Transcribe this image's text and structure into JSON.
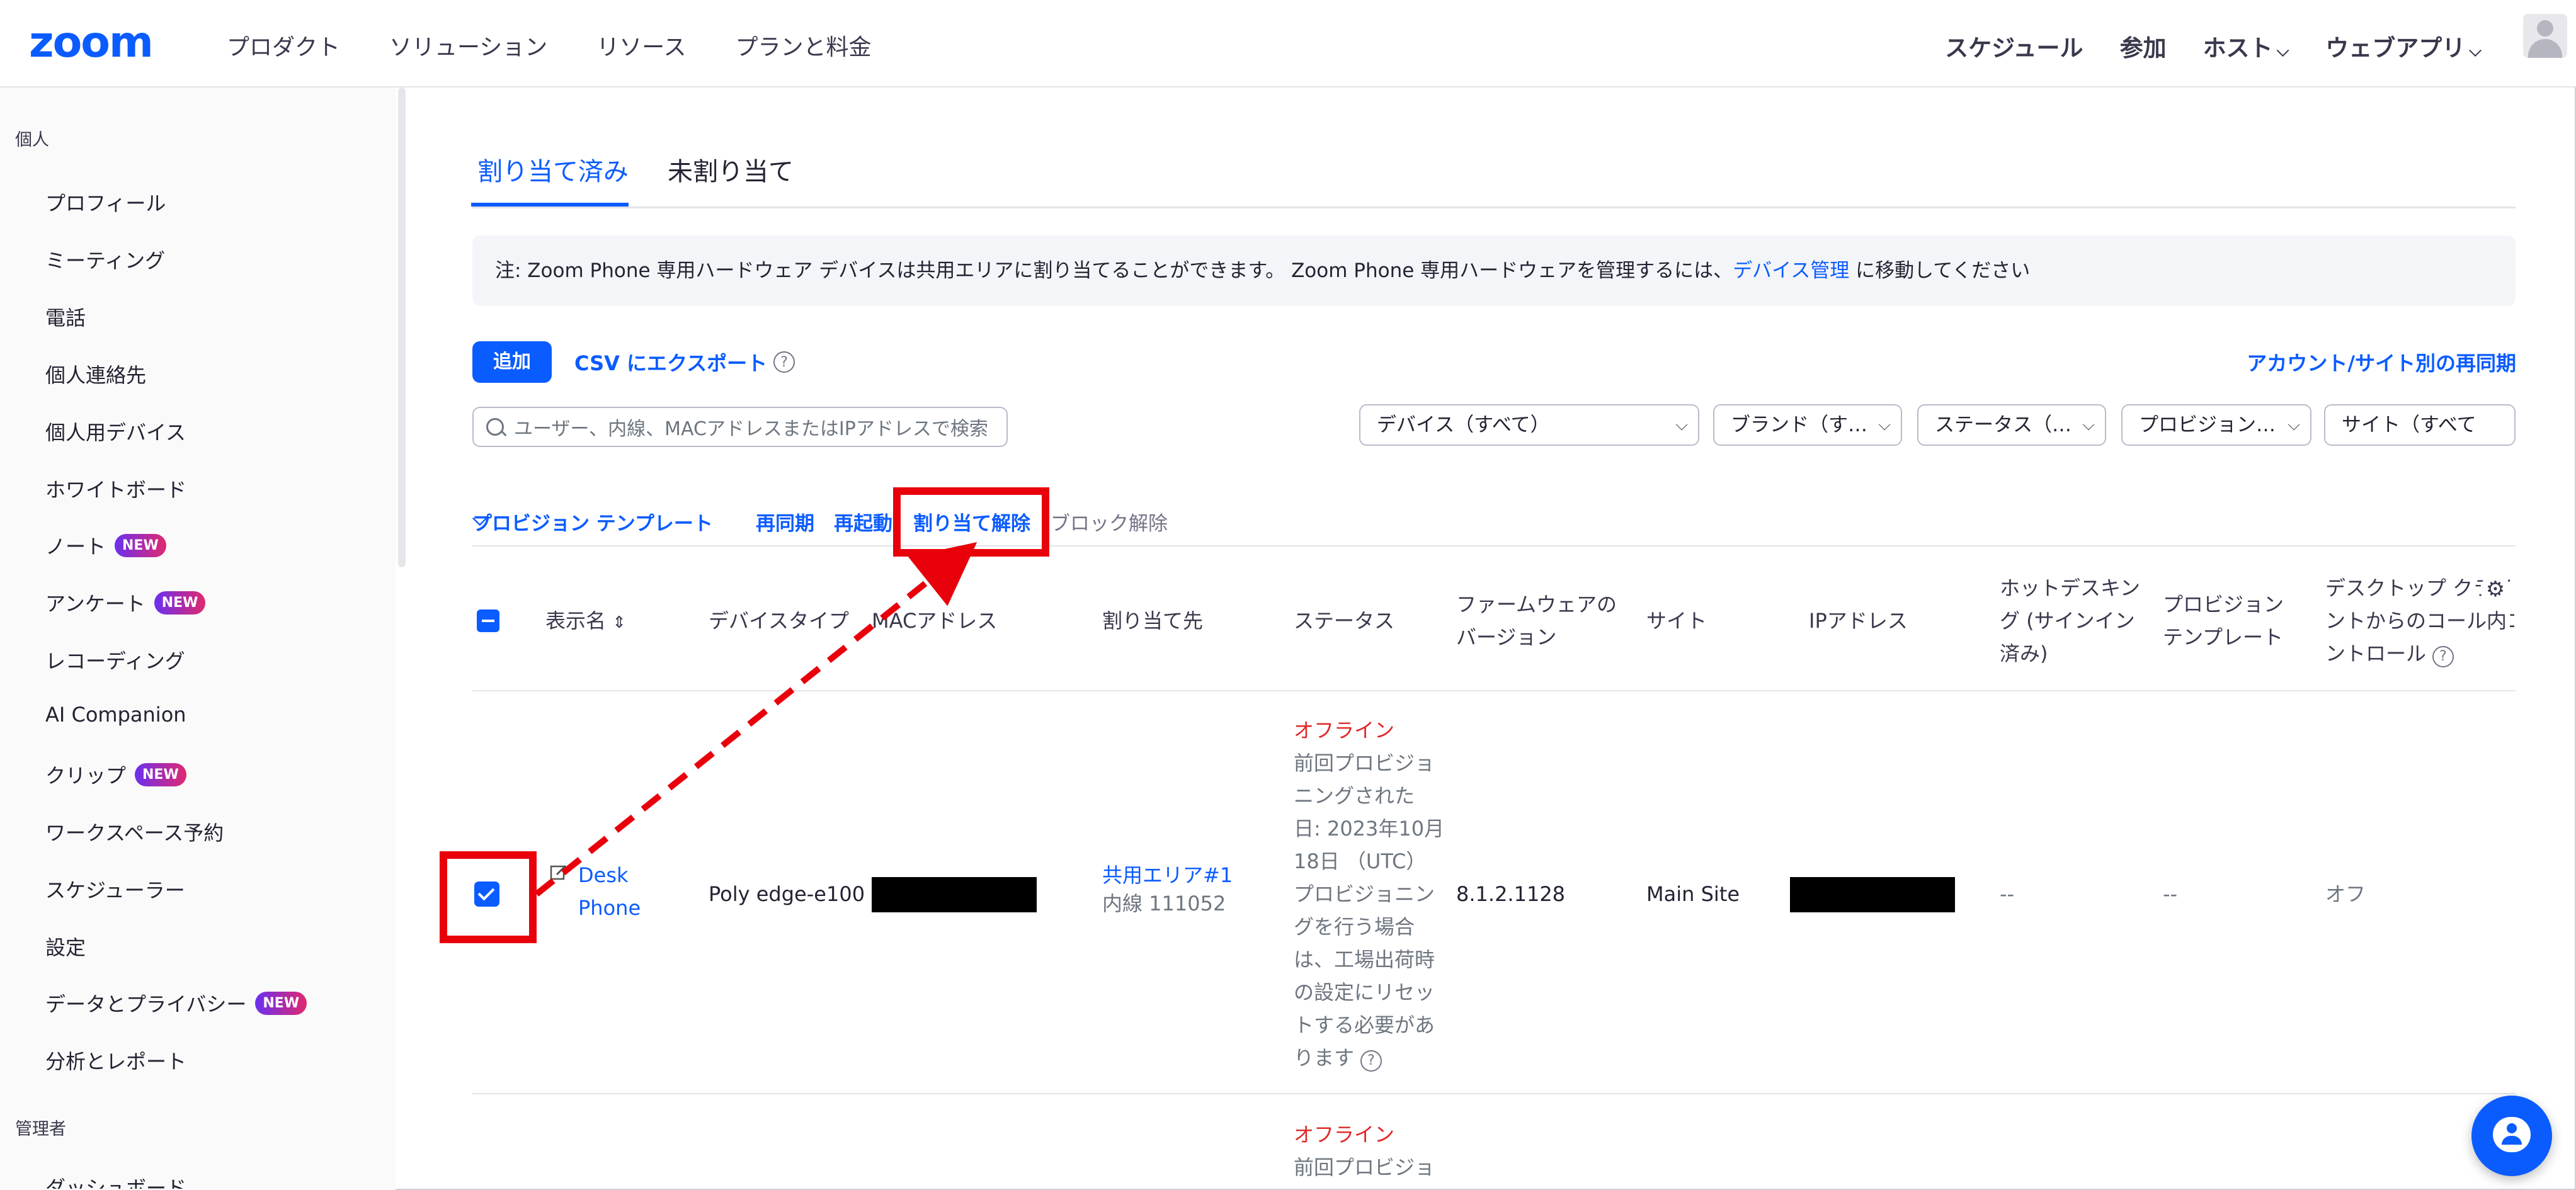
{
  "topnav": {
    "logo": "zoom",
    "left_items": [
      "プロダクト",
      "ソリューション",
      "リソース",
      "プランと料金"
    ],
    "right_items": [
      {
        "label": "スケジュール",
        "dropdown": false
      },
      {
        "label": "参加",
        "dropdown": false
      },
      {
        "label": "ホスト",
        "dropdown": true
      },
      {
        "label": "ウェブアプリ",
        "dropdown": true
      }
    ],
    "chevron": "⌵"
  },
  "sidebar": {
    "section_personal": "個人",
    "items": [
      {
        "label": "プロフィール",
        "badge": ""
      },
      {
        "label": "ミーティング",
        "badge": ""
      },
      {
        "label": "電話",
        "badge": ""
      },
      {
        "label": "個人連絡先",
        "badge": ""
      },
      {
        "label": "個人用デバイス",
        "badge": ""
      },
      {
        "label": "ホワイトボード",
        "badge": ""
      },
      {
        "label": "ノート",
        "badge": "NEW"
      },
      {
        "label": "アンケート",
        "badge": "NEW"
      },
      {
        "label": "レコーディング",
        "badge": ""
      },
      {
        "label": "AI Companion",
        "badge": ""
      },
      {
        "label": "クリップ",
        "badge": "NEW"
      },
      {
        "label": "ワークスペース予約",
        "badge": ""
      },
      {
        "label": "スケジューラー",
        "badge": ""
      },
      {
        "label": "設定",
        "badge": ""
      },
      {
        "label": "データとプライバシー",
        "badge": "NEW"
      },
      {
        "label": "分析とレポート",
        "badge": ""
      }
    ],
    "section_admin": "管理者",
    "admin_partial": "ダッシュボード"
  },
  "tabs": {
    "assigned": "割り当て済み",
    "unassigned": "未割り当て"
  },
  "notice": {
    "text": "注: Zoom Phone 専用ハードウェア デバイスは共用エリアに割り当てることができます。 Zoom Phone 専用ハードウェアを管理するには、",
    "link": "デバイス管理",
    "suffix": " に移動してください"
  },
  "toolbar": {
    "add": "追加",
    "csv": "CSV にエクスポート",
    "help": "?",
    "resync": "アカウント/サイト別の再同期",
    "search_placeholder": "ユーザー、内線、MACアドレスまたはIPアドレスで検索"
  },
  "filters": [
    "デバイス（すべて）",
    "ブランド（す…",
    "ステータス（…",
    "プロビジョン…",
    "サイト（すべて"
  ],
  "actions": {
    "provision_template": "プロビジョン テンプレート",
    "resync": "再同期",
    "reboot": "再起動",
    "unassign": "割り当て解除",
    "unblock": "ブロック解除"
  },
  "table": {
    "headers": {
      "display_name": "表示名",
      "sort_icon": "⇕",
      "device_type": "デバイスタイプ",
      "mac": "MACアドレス",
      "assigned_to": "割り当て先",
      "status": "ステータス",
      "firmware_1": "ファームウェアの",
      "firmware_2": "バージョン",
      "site": "サイト",
      "ip": "IPアドレス",
      "hotdesk_1": "ホットデスキン",
      "hotdesk_2": "グ (サインイン",
      "hotdesk_3": "済み)",
      "template_1": "プロビジョン",
      "template_2": "テンプレート",
      "desktop_1": "デスクトップ クライア",
      "desktop_2": "ントからのコール内コ",
      "desktop_3": "ントロール"
    },
    "row1": {
      "name_1": "Desk",
      "name_2": "Phone",
      "device_type": "Poly edge-e100",
      "assigned_to": "共用エリア#1",
      "extension": "内線 111052",
      "status": "オフライン",
      "status_detail": [
        "前回プロビジョ",
        "ニングされた",
        "日: 2023年10月",
        "18日 （UTC）",
        "プロビジョニン",
        "グを行う場合",
        "は、工場出荷時",
        "の設定にリセッ",
        "トする必要があ",
        "ります"
      ],
      "firmware": "8.1.2.1128",
      "site": "Main Site",
      "hotdesk": "--",
      "template": "--",
      "desktop_control": "オフ"
    },
    "row2": {
      "status": "オフライン",
      "status_detail": "前回プロビジョ"
    }
  },
  "colors": {
    "accent": "#0b5cff",
    "highlight": "#e8000b",
    "offline": "#e02828"
  }
}
